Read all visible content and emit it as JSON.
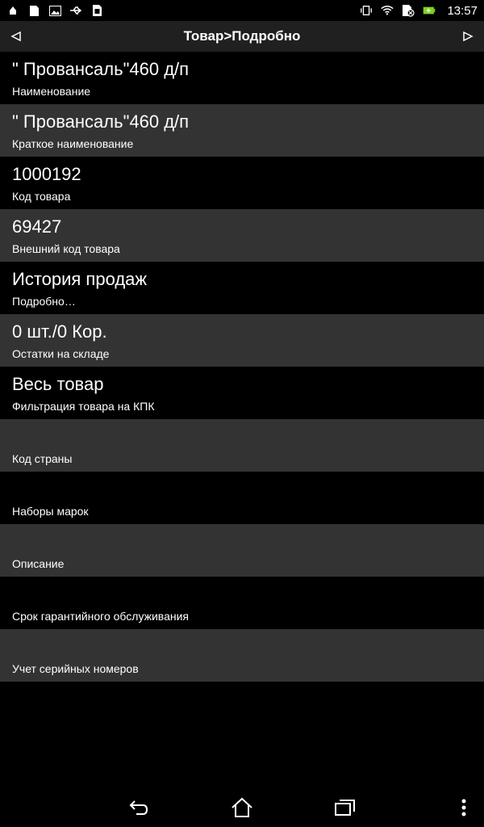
{
  "statusbar": {
    "time": "13:57",
    "left_icons": [
      "notification-icon",
      "sd-card-icon",
      "image-icon",
      "usb-icon",
      "sim-icon"
    ],
    "right_icons": [
      "vibrate-icon",
      "wifi-icon",
      "no-sim-icon",
      "battery-charging-icon"
    ]
  },
  "header": {
    "title": "Товар>Подробно",
    "back_icon": "left-triangle-icon",
    "forward_icon": "right-triangle-icon"
  },
  "fields": [
    {
      "value": "\" Провансаль\"460 д/п",
      "label": "Наименование"
    },
    {
      "value": "\" Провансаль\"460 д/п",
      "label": "Краткое наименование"
    },
    {
      "value": "1000192",
      "label": "Код товара"
    },
    {
      "value": "69427",
      "label": "Внешний код товара"
    },
    {
      "value": "История продаж",
      "label": "Подробно…"
    },
    {
      "value": "0 шт./0 Кор.",
      "label": "Остатки на складе"
    },
    {
      "value": "Весь товар",
      "label": "Фильтрация товара на КПК"
    },
    {
      "value": "",
      "label": "Код страны"
    },
    {
      "value": "",
      "label": "Наборы марок"
    },
    {
      "value": "",
      "label": "Описание"
    },
    {
      "value": "",
      "label": "Срок гарантийного обслуживания"
    },
    {
      "value": "",
      "label": "Учет серийных номеров"
    }
  ],
  "navbar": {
    "back_icon": "back-icon",
    "home_icon": "home-icon",
    "recents_icon": "recents-icon",
    "menu_icon": "overflow-menu-icon"
  },
  "colors": {
    "background": "#000000",
    "row_alt": "#333333",
    "titlebar": "#202020",
    "battery": "#7ed321"
  }
}
